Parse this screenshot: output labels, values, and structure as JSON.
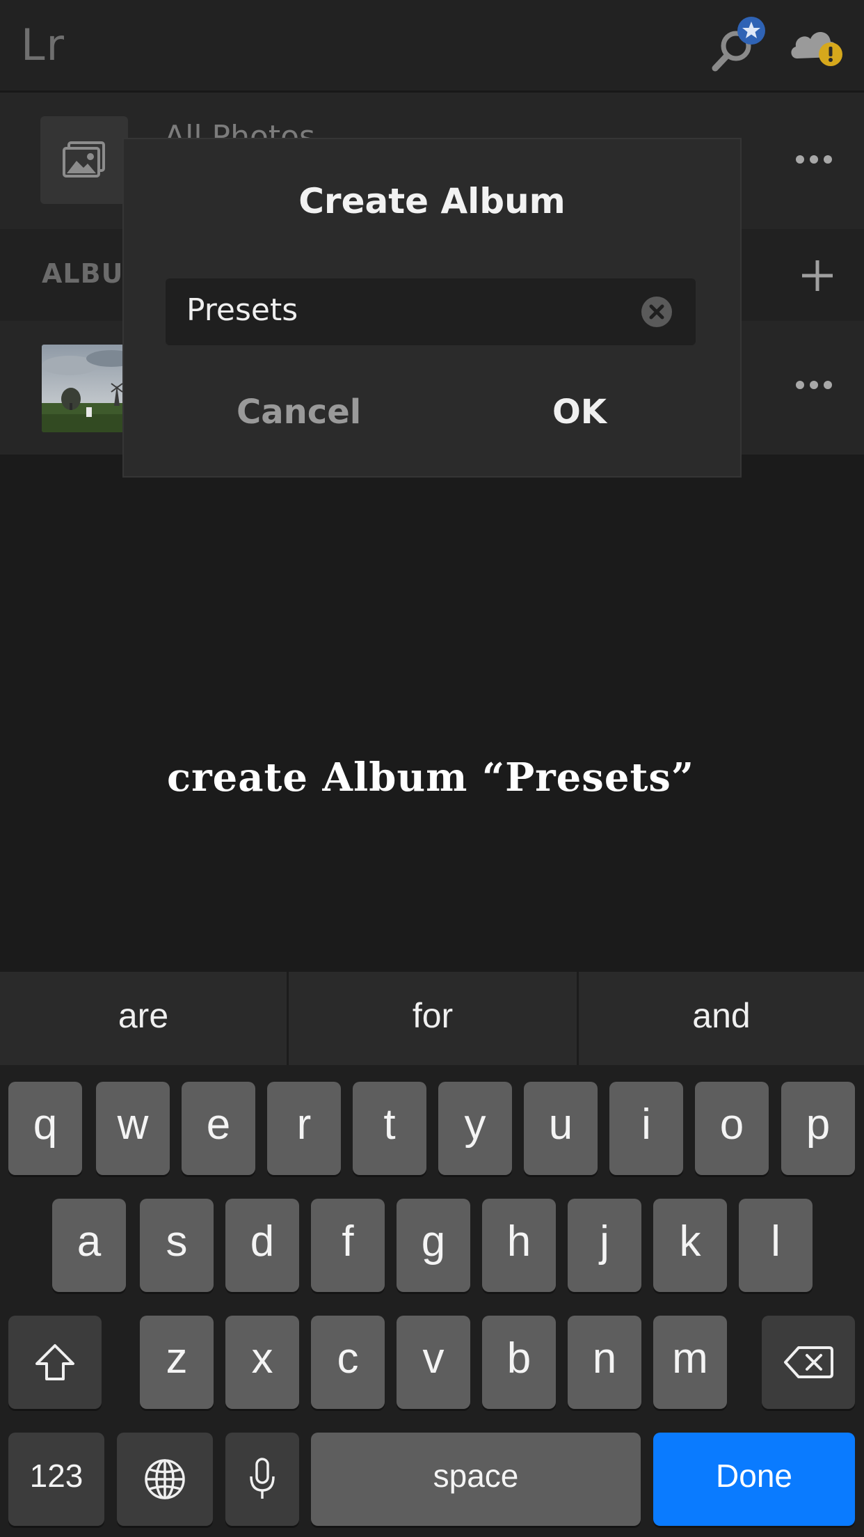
{
  "app": {
    "logo_text": "Lr"
  },
  "topbar": {
    "search_icon": "search-icon",
    "search_badge_icon": "star-icon",
    "cloud_icon": "cloud-warning-icon"
  },
  "all_photos": {
    "label": "All Photos",
    "thumb_icon": "photo-icon",
    "more_icon": "more-icon"
  },
  "albums": {
    "header_label": "ALBUMS",
    "add_icon": "plus-icon",
    "row_more_icon": "more-icon"
  },
  "dialog": {
    "title": "Create Album",
    "input_value": "Presets",
    "clear_icon": "clear-icon",
    "cancel_label": "Cancel",
    "ok_label": "OK"
  },
  "caption": "create Album “Presets”",
  "keyboard": {
    "suggestions": [
      "are",
      "for",
      "and"
    ],
    "row1": [
      "q",
      "w",
      "e",
      "r",
      "t",
      "y",
      "u",
      "i",
      "o",
      "p"
    ],
    "row2": [
      "a",
      "s",
      "d",
      "f",
      "g",
      "h",
      "j",
      "k",
      "l"
    ],
    "row3": [
      "z",
      "x",
      "c",
      "v",
      "b",
      "n",
      "m"
    ],
    "shift_icon": "shift-icon",
    "backspace_icon": "backspace-icon",
    "numbers_label": "123",
    "globe_icon": "globe-icon",
    "mic_icon": "microphone-icon",
    "space_label": "space",
    "done_label": "Done"
  },
  "colors": {
    "background": "#1b1b1b",
    "dialog": "#2b2b2b",
    "key": "#5e5e5e",
    "done_key": "#0a7bff",
    "badge_star": "#2f63b5",
    "badge_warning": "#d6a81c"
  }
}
